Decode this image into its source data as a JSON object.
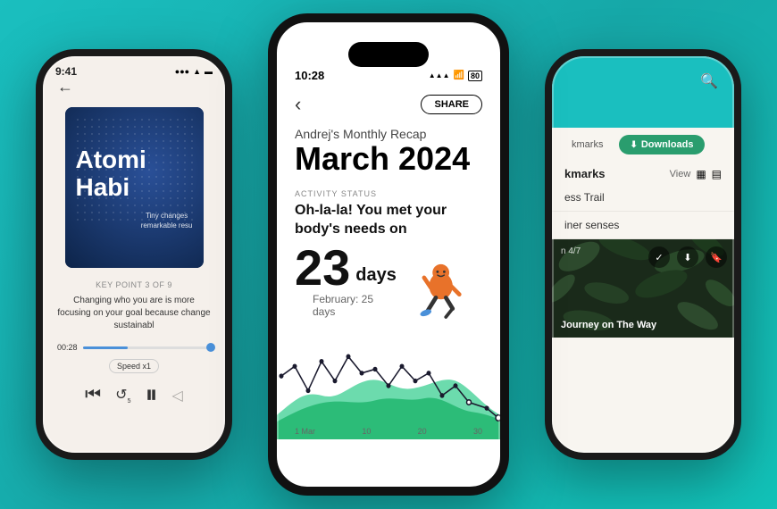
{
  "background_color": "#1abfbf",
  "left_phone": {
    "status_time": "9:41",
    "book_title": "Atomi\nHabi",
    "book_subtitle_line1": "Tiny changes",
    "book_subtitle_line2": "remarkable resu",
    "key_point_label": "KEY POINT 3 OF 9",
    "key_point_text": "Changing who you are is more\nfocusing on your goal because\nchange sustainabl",
    "audio_time": "00:28",
    "speed_label": "Speed x1",
    "back_icon": "←"
  },
  "center_phone": {
    "status_time": "10:28",
    "status_location": "◀",
    "share_label": "SHARE",
    "back_icon": "‹",
    "recap_label": "Andrej's Monthly Recap",
    "recap_month": "March 2024",
    "activity_section_label": "ACTIVITY STATUS",
    "activity_text_line1": "Oh-la-la! You met your",
    "activity_text_line2": "body's needs on",
    "days_number": "23",
    "days_unit": "days",
    "prev_month_label": "February: 25 days",
    "chart_labels": [
      "1 Mar",
      "10",
      "20",
      "30"
    ]
  },
  "right_phone": {
    "tab_bookmarks": "kmarks",
    "tab_downloads": "Downloads",
    "section_header": "kmarks",
    "section_view_label": "View",
    "list_item_1": "ess Trail",
    "list_item_2": "iner senses",
    "thumbnail_label": "n 4/7",
    "thumbnail_title": "Journey on The Way",
    "search_icon": "🔍"
  }
}
